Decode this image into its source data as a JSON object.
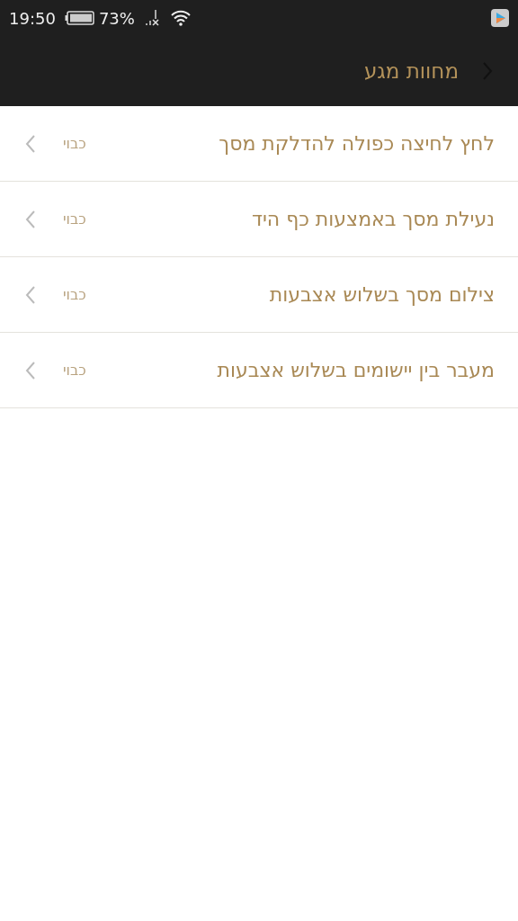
{
  "status_bar": {
    "time": "19:50",
    "battery_text": "73%"
  },
  "header": {
    "title": "מחוות מגע"
  },
  "items": [
    {
      "label": "לחץ לחיצה כפולה להדלקת מסך",
      "value": "כבוי"
    },
    {
      "label": "נעילת מסך באמצעות כף היד",
      "value": "כבוי"
    },
    {
      "label": "צילום מסך בשלוש אצבעות",
      "value": "כבוי"
    },
    {
      "label": "מעבר בין יישומים בשלוש אצבעות",
      "value": "כבוי"
    }
  ]
}
